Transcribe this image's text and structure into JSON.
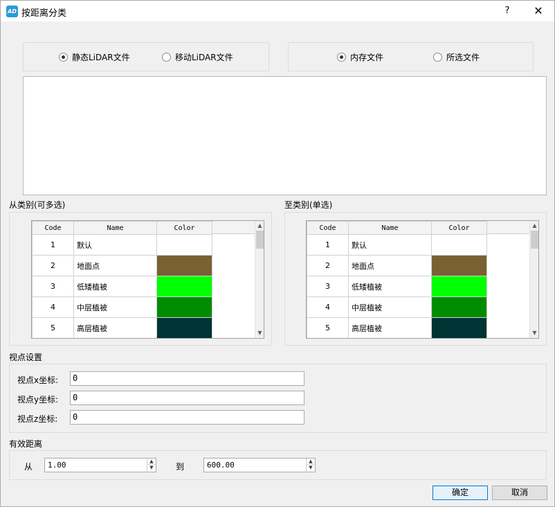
{
  "window": {
    "title": "按距离分类",
    "app_icon": "AD",
    "help": "?",
    "close": "✕"
  },
  "source_type": {
    "options": [
      {
        "label": "静态LiDAR文件",
        "checked": true
      },
      {
        "label": "移动LiDAR文件",
        "checked": false
      }
    ]
  },
  "file_source": {
    "options": [
      {
        "label": "内存文件",
        "checked": true
      },
      {
        "label": "所选文件",
        "checked": false
      }
    ]
  },
  "from_class": {
    "label": "从类别(可多选)",
    "headers": [
      "Code",
      "Name",
      "Color"
    ],
    "rows": [
      {
        "code": "1",
        "name": "默认",
        "color": "#ffffff"
      },
      {
        "code": "2",
        "name": "地面点",
        "color": "#7a6133"
      },
      {
        "code": "3",
        "name": "低矮植被",
        "color": "#00ff00"
      },
      {
        "code": "4",
        "name": "中层植被",
        "color": "#008c00"
      },
      {
        "code": "5",
        "name": "高层植被",
        "color": "#003333"
      }
    ]
  },
  "to_class": {
    "label": "至类别(单选)",
    "headers": [
      "Code",
      "Name",
      "Color"
    ],
    "rows": [
      {
        "code": "1",
        "name": "默认",
        "color": "#ffffff"
      },
      {
        "code": "2",
        "name": "地面点",
        "color": "#7a6133"
      },
      {
        "code": "3",
        "name": "低矮植被",
        "color": "#00ff00"
      },
      {
        "code": "4",
        "name": "中层植被",
        "color": "#008c00"
      },
      {
        "code": "5",
        "name": "高层植被",
        "color": "#003333"
      }
    ]
  },
  "viewpoint": {
    "label": "视点设置",
    "x_label": "视点x坐标:",
    "x_value": "0",
    "y_label": "视点y坐标:",
    "y_value": "0",
    "z_label": "视点z坐标:",
    "z_value": "0"
  },
  "distance": {
    "label": "有效距离",
    "from_label": "从",
    "from_value": "1.00",
    "to_label": "到",
    "to_value": "600.00"
  },
  "buttons": {
    "ok": "确定",
    "cancel": "取消"
  }
}
